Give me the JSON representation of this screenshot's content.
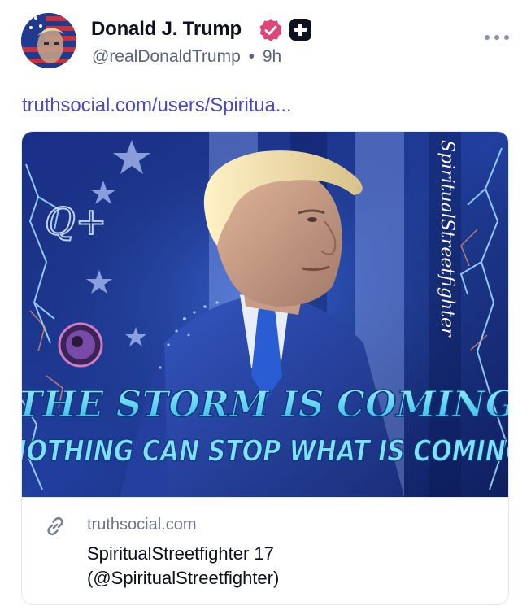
{
  "post": {
    "author": {
      "display_name": "Donald J. Trump",
      "handle": "@realDonaldTrump",
      "separator": "•",
      "time_ago": "9h"
    },
    "link_text": "truthsocial.com/users/Spiritua...",
    "card": {
      "image": {
        "headline": "THE STORM IS COMING",
        "subheadline": "NOTHING CAN STOP WHAT IS COMING",
        "signature": "SpiritualStreetfighter",
        "q_mark": "Q+"
      },
      "domain": "truthsocial.com",
      "title_line1": "SpiritualStreetfighter 17",
      "title_line2": "(@SpiritualStreetfighter)"
    }
  },
  "icons": {
    "verified": "verified-badge-icon",
    "plus": "plus-icon",
    "more": "more-options-icon",
    "link": "link-icon"
  },
  "colors": {
    "link": "#4b4bbf",
    "verified": "#e0457a",
    "text_secondary": "#5a6478",
    "image_blue": "#1c3d9c",
    "headline_cyan": "#5fd6ff"
  }
}
